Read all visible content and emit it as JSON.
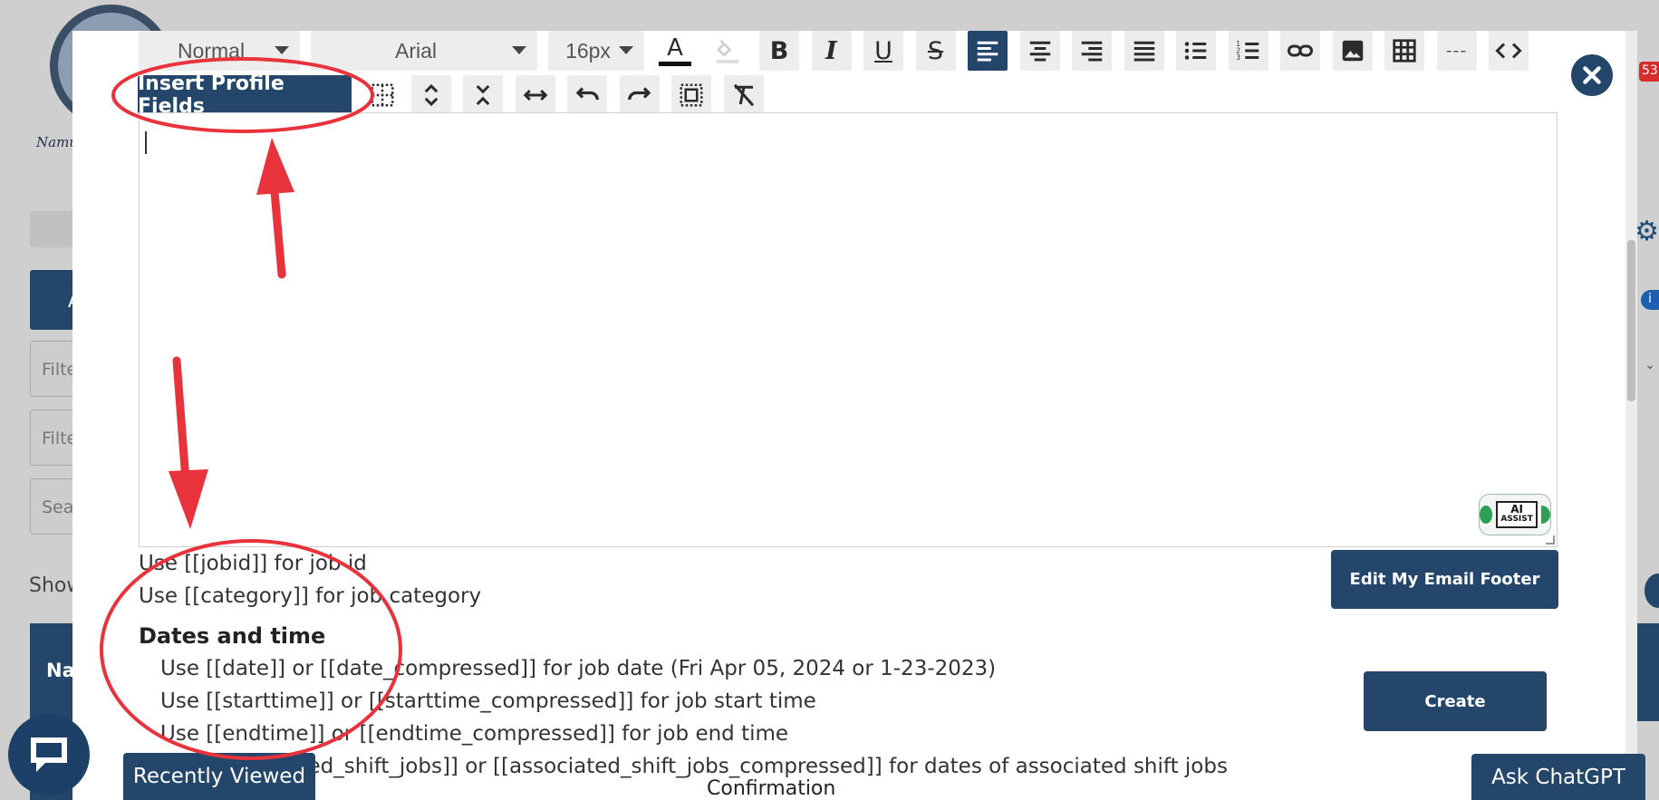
{
  "background": {
    "show_label": "Show",
    "navy_label": "Na",
    "filter_placeholder_1": "Filte",
    "filter_placeholder_2": "Filte",
    "search_placeholder": "Sea",
    "button_partial": "A",
    "logo_text": "Namu",
    "badge_count": "53"
  },
  "toolbar": {
    "paragraph_style": "Normal",
    "font_family": "Arial",
    "font_size": "16px",
    "bold": "B",
    "italic": "I",
    "underline": "U",
    "strike": "S",
    "text_color_glyph": "A",
    "horizontal_rule": "---",
    "insert_profile_fields": "Insert Profile Fields"
  },
  "ai_badge": {
    "line1": "AI",
    "line2": "ASSIST"
  },
  "help": {
    "jobid": "Use [[jobid]] for job id",
    "category": "Use [[category]] for job category",
    "dates_heading": "Dates and time",
    "date": "Use [[date]] or [[date_compressed]] for job date (Fri Apr 05, 2024 or 1-23-2023)",
    "starttime": "Use [[starttime]] or [[starttime_compressed]] for job start time",
    "endtime": "Use [[endtime]] or [[endtime_compressed]] for job end time",
    "associated": "Use [[associated_shift_jobs]] or [[associated_shift_jobs_compressed]] for dates of associated shift jobs"
  },
  "buttons": {
    "edit_footer": "Edit My Email Footer",
    "create": "Create",
    "recently_viewed": "Recently Viewed",
    "ask_chatgpt": "Ask ChatGPT"
  },
  "confirmation_label": "Confirmation",
  "colors": {
    "navy": "#24466a",
    "annotation_red": "#e8323c",
    "toolbar_gray": "#ededed"
  }
}
